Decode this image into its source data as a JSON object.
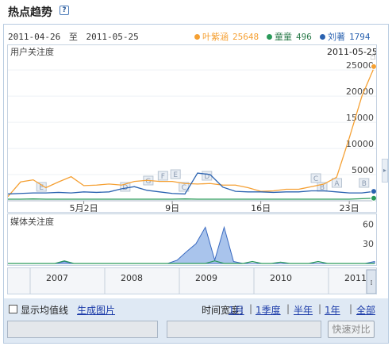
{
  "header": {
    "title": "热点趋势",
    "help_icon": "?"
  },
  "date_range": {
    "start": "2011-04-26",
    "sep": "至",
    "end": "2011-05-25"
  },
  "legend": [
    {
      "name": "叶紫涵",
      "value": "25648",
      "color": "#f5a033"
    },
    {
      "name": "童童",
      "value": "496",
      "color": "#2a9a5a"
    },
    {
      "name": "刘著",
      "value": "1794",
      "color": "#2a62b0"
    }
  ],
  "user_chart": {
    "label": "用户关注度",
    "hover_date": "2011-05-25",
    "y_ticks": [
      "25000",
      "20000",
      "15000",
      "10000",
      "5000"
    ],
    "x_ticks": [
      "5月2日",
      "9日",
      "16日",
      "23日"
    ],
    "event_markers": [
      "E",
      "D",
      "G",
      "F",
      "E",
      "D",
      "C",
      "B",
      "C",
      "B",
      "A"
    ]
  },
  "chart_data": [
    {
      "type": "line",
      "title": "用户关注度",
      "x": [
        "04-26",
        "04-27",
        "04-28",
        "04-29",
        "04-30",
        "05-01",
        "05-02",
        "05-03",
        "05-04",
        "05-05",
        "05-06",
        "05-07",
        "05-08",
        "05-09",
        "05-10",
        "05-11",
        "05-12",
        "05-13",
        "05-14",
        "05-15",
        "05-16",
        "05-17",
        "05-18",
        "05-19",
        "05-20",
        "05-21",
        "05-22",
        "05-23",
        "05-24",
        "05-25"
      ],
      "x_tick_labels": [
        "5月2日",
        "9日",
        "16日",
        "23日"
      ],
      "ylim": [
        0,
        27000
      ],
      "y_ticks": [
        5000,
        10000,
        15000,
        20000,
        25000
      ],
      "series": [
        {
          "name": "叶紫涵",
          "color": "#f5a033",
          "values": [
            800,
            3600,
            4000,
            2500,
            3600,
            4600,
            2900,
            3000,
            3200,
            3000,
            3700,
            3900,
            3700,
            3700,
            3300,
            3200,
            3300,
            3000,
            3000,
            2500,
            1800,
            1900,
            2200,
            2200,
            2700,
            3200,
            4500,
            12000,
            20000,
            25648
          ]
        },
        {
          "name": "刘著",
          "color": "#2a62b0",
          "values": [
            1300,
            1400,
            1500,
            1500,
            1600,
            1500,
            1700,
            1600,
            1700,
            2300,
            2700,
            2000,
            1700,
            1400,
            1300,
            5300,
            5000,
            2600,
            1800,
            1700,
            1700,
            1600,
            1700,
            1700,
            1900,
            1900,
            1700,
            1500,
            1500,
            1794
          ]
        },
        {
          "name": "童童",
          "color": "#2a9a5a",
          "values": [
            300,
            300,
            350,
            300,
            300,
            300,
            300,
            300,
            300,
            300,
            300,
            300,
            300,
            300,
            350,
            300,
            300,
            300,
            300,
            300,
            300,
            300,
            300,
            300,
            300,
            300,
            300,
            300,
            400,
            496
          ]
        }
      ]
    },
    {
      "type": "area",
      "title": "媒体关注度",
      "ylim": [
        0,
        70
      ],
      "y_ticks": [
        30,
        60
      ],
      "x": [
        "2007-01",
        "2007-04",
        "2007-07",
        "2007-10",
        "2008-01",
        "2008-04",
        "2008-07",
        "2008-10",
        "2009-01",
        "2009-04",
        "2009-07",
        "2009-10",
        "2010-01",
        "2010-04",
        "2010-07",
        "2010-10",
        "2011-01",
        "2011-04"
      ],
      "series": [
        {
          "name": "叶紫涵",
          "color": "#6a9ade",
          "values": [
            0,
            0,
            0,
            0,
            0,
            0,
            0,
            0,
            0,
            0,
            0,
            0,
            0,
            0,
            0,
            0,
            0,
            0
          ]
        }
      ]
    }
  ],
  "media_chart": {
    "label": "媒体关注度",
    "y_ticks": [
      "60",
      "30"
    ],
    "points": [
      0,
      0,
      0,
      0,
      0,
      0,
      3,
      0,
      0,
      0,
      0,
      0,
      0,
      0,
      0,
      0,
      0,
      0,
      5,
      18,
      30,
      55,
      5,
      55,
      3,
      0,
      0,
      0,
      0,
      0,
      0,
      0,
      0,
      0,
      0,
      0,
      0,
      0,
      0,
      3
    ],
    "green_points": [
      0,
      0,
      0,
      0,
      0,
      0,
      4,
      0,
      0,
      0,
      0,
      0,
      0,
      0,
      0,
      0,
      0,
      0,
      0,
      0,
      0,
      0,
      4,
      0,
      0,
      0,
      3,
      0,
      0,
      2,
      0,
      0,
      0,
      3,
      0,
      0,
      0,
      0,
      0,
      0
    ]
  },
  "timeline": {
    "years": [
      "2007",
      "2008",
      "2009",
      "2010",
      "2011"
    ]
  },
  "controls": {
    "avg_label": "显示均值线",
    "gen_image": "生成图片",
    "time_width_label": "时间宽度：",
    "tw_options": [
      "1月",
      "1季度",
      "半年",
      "1年",
      "全部"
    ],
    "compare_button": "快速对比"
  }
}
